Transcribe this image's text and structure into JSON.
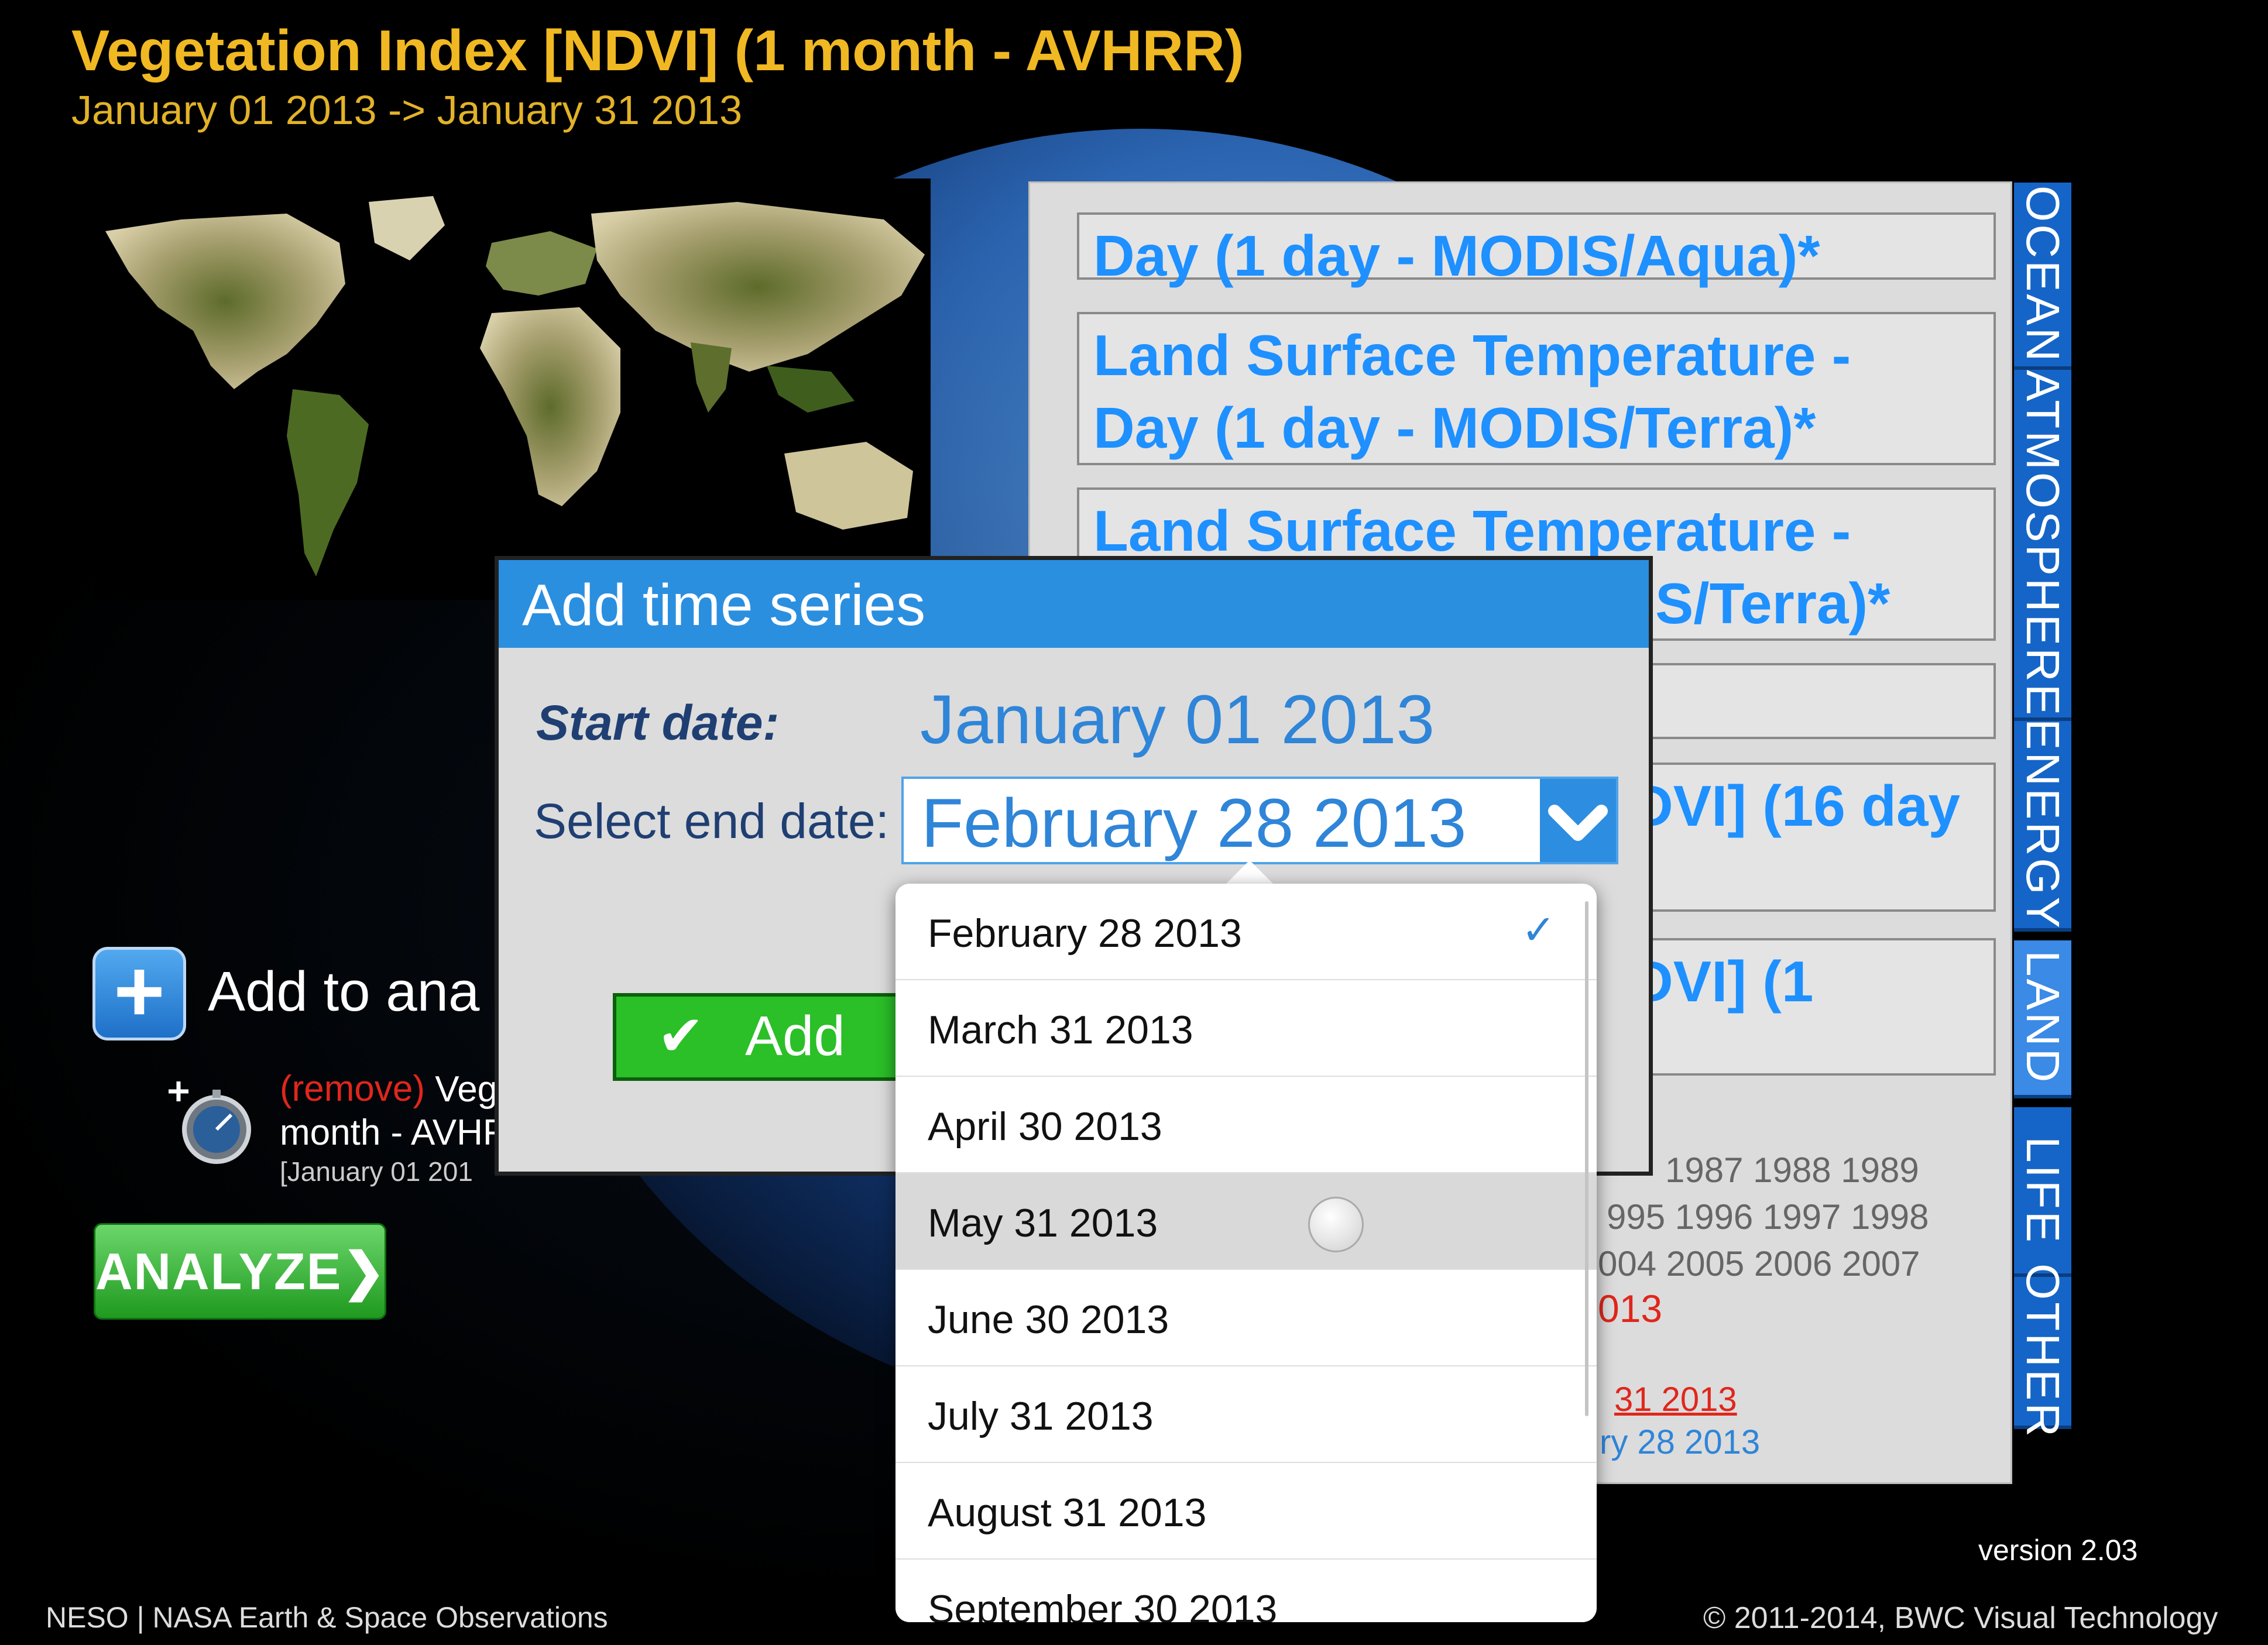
{
  "header": {
    "title": "Vegetation Index [NDVI] (1 month - AVHRR)",
    "subtitle": "January 01 2013 -> January 31 2013"
  },
  "layer_panel": {
    "items": [
      {
        "line1": "Day (1 day - MODIS/Aqua)*",
        "line2": ""
      },
      {
        "line1": "Land Surface Temperature -",
        "line2": "Day (1 day - MODIS/Terra)*"
      },
      {
        "line1": "Land Surface Temperature -",
        "line2": "S/Terra)*"
      },
      {
        "line1": "",
        "line2": ""
      },
      {
        "line1": "DVI] (16 day",
        "line2": ""
      },
      {
        "line1": "DVI] (1",
        "line2": ""
      }
    ],
    "years": [
      "1987 1988 1989",
      "995 1996 1997 1998",
      "004 2005 2006 2007"
    ],
    "selected_year": "013",
    "range_links": [
      {
        "text": "31 2013",
        "color": "#e0261c"
      },
      {
        "text": "ry 28 2013",
        "color": "#2f85d8"
      }
    ]
  },
  "category_tabs": [
    {
      "label": "OCEAN",
      "active": false
    },
    {
      "label": "ATMOSPHERE",
      "active": false
    },
    {
      "label": "ENERGY",
      "active": false
    },
    {
      "label": "LAND",
      "active": true
    },
    {
      "label": "LIFE",
      "active": false
    },
    {
      "label": "OTHER",
      "active": false
    }
  ],
  "analysis": {
    "add_label": "Add to ana",
    "remove_label": "(remove)",
    "item_text": "Veg",
    "item_text_line2": "month - AVHF",
    "item_range": "[January 01 201",
    "analyze_label": "ANALYZE"
  },
  "dialog": {
    "title": "Add time series",
    "start_label": "Start date:",
    "start_value": "January 01 2013",
    "end_label": "Select end date:",
    "end_value": "February 28 2013",
    "add_label": "Add"
  },
  "date_options": [
    {
      "label": "February 28 2013",
      "selected": true
    },
    {
      "label": "March 31 2013",
      "selected": false
    },
    {
      "label": "April 30 2013",
      "selected": false
    },
    {
      "label": "May 31 2013",
      "selected": false,
      "highlighted": true
    },
    {
      "label": "June 30 2013",
      "selected": false
    },
    {
      "label": "July 31 2013",
      "selected": false
    },
    {
      "label": "August 31 2013",
      "selected": false
    },
    {
      "label": "September 30 2013",
      "selected": false
    }
  ],
  "footer": {
    "left": "NESO | NASA Earth & Space Observations",
    "version": "version 2.03",
    "copyright": "© 2011-2014, BWC Visual Technology"
  },
  "colors": {
    "title": "#f0b822",
    "accent_blue": "#2b8fe0",
    "tab_blue": "#1565c8",
    "add_green": "#2bbf28",
    "remove_red": "#e0261c"
  }
}
